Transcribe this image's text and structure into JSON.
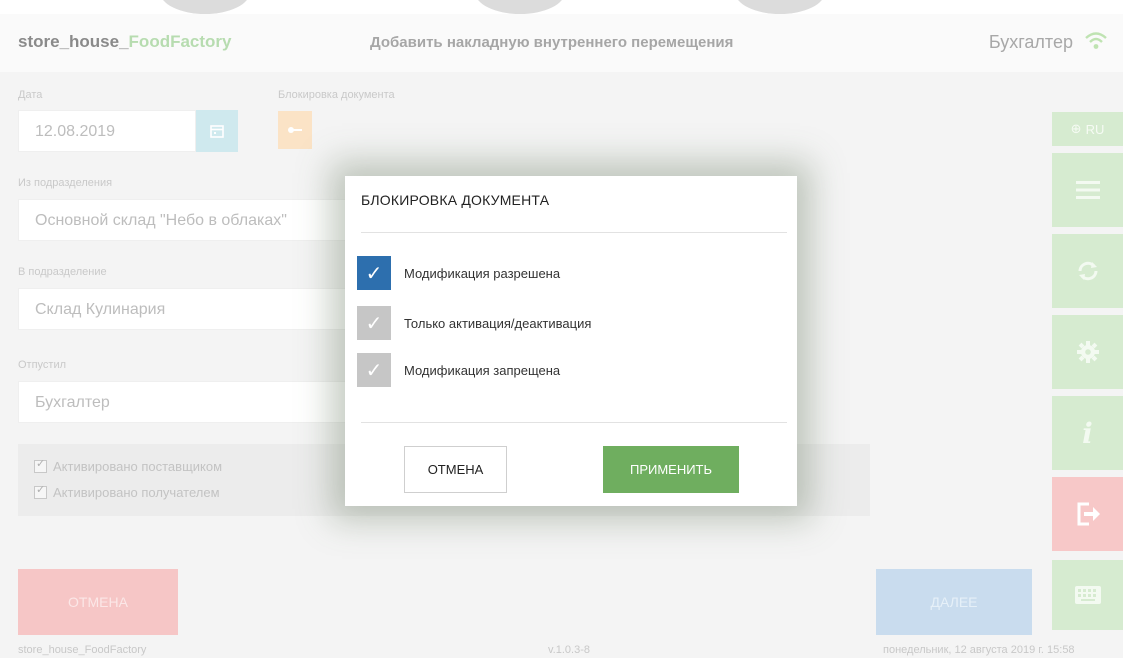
{
  "header": {
    "brand_prefix": "store_house_",
    "brand_accent": "FoodFactory",
    "title": "Добавить накладную внутреннего перемещения",
    "user": "Бухгалтер"
  },
  "form": {
    "date_label": "Дата",
    "date_value": "12.08.2019",
    "lock_label": "Блокировка документа",
    "from_label": "Из подразделения",
    "from_value": "Основной склад \"Небо в облаках\"",
    "to_label": "В подразделение",
    "to_value": "Склад Кулинария",
    "released_label": "Отпустил",
    "released_value": "Бухгалтер",
    "checks": [
      {
        "label": "Активировано поставщиком",
        "checked": true
      },
      {
        "label": "Активировано получателем",
        "checked": true
      }
    ]
  },
  "sidebar": {
    "lang": "RU"
  },
  "buttons": {
    "cancel": "ОТМЕНА",
    "next": "ДАЛЕЕ"
  },
  "footer": {
    "app": "store_house_FoodFactory",
    "version": "v.1.0.3-8",
    "datetime": "понедельник, 12 августа 2019 г. 15:58"
  },
  "modal": {
    "title": "БЛОКИРОВКА ДОКУМЕНТА",
    "options": [
      {
        "label": "Модификация разрешена",
        "selected": true
      },
      {
        "label": "Только активация/деактивация",
        "selected": false
      },
      {
        "label": "Модификация запрещена",
        "selected": false
      }
    ],
    "cancel_label": "ОТМЕНА",
    "apply_label": "ПРИМЕНИТЬ"
  },
  "colors": {
    "accent_green": "#6fae5f",
    "selected_blue": "#2d6fae",
    "unselected_gray": "#c6c6c6",
    "sidebar_green": "#d6ebd0",
    "sidebar_red": "#f7c8c8"
  }
}
